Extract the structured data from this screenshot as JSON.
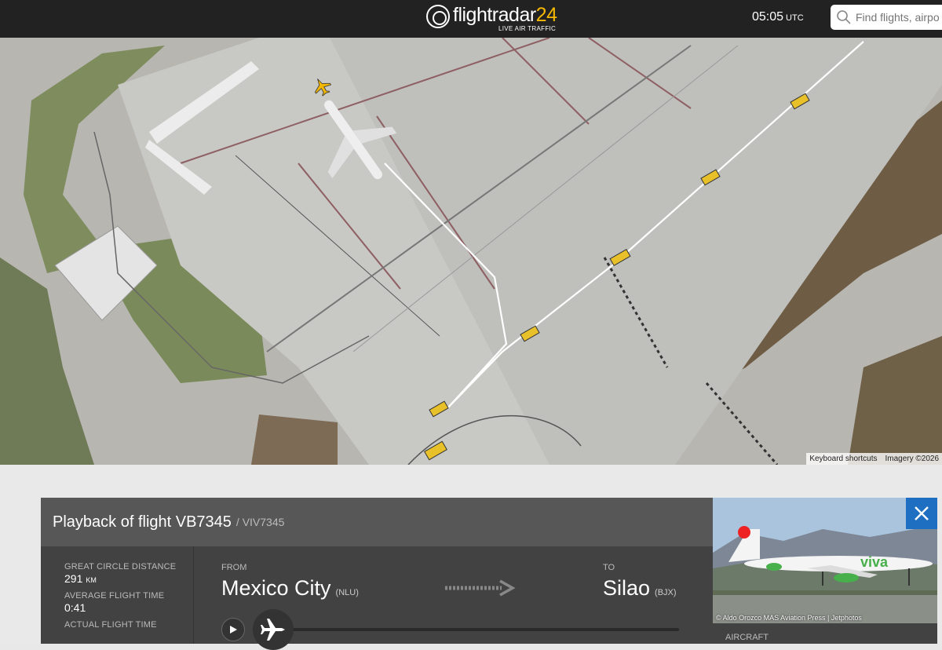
{
  "header": {
    "logo_text_main": "flightradar",
    "logo_text_num": "24",
    "logo_subtitle": "LIVE AIR TRAFFIC",
    "time": "05:05",
    "time_zone": "UTC",
    "search_placeholder": "Find flights, airpo"
  },
  "map": {
    "attribution": [
      "Keyboard shortcuts",
      "Imagery ©2026"
    ]
  },
  "flight_panel": {
    "title": "Playback of flight VB7345",
    "subtitle": "/ VIV7345",
    "stats": [
      {
        "label": "GREAT CIRCLE DISTANCE",
        "value": "291",
        "unit": "KM"
      },
      {
        "label": "AVERAGE FLIGHT TIME",
        "value": "0:41",
        "unit": ""
      },
      {
        "label": "ACTUAL FLIGHT TIME",
        "value": "",
        "unit": ""
      }
    ],
    "from_label": "FROM",
    "from_city": "Mexico City",
    "from_code": "(NLU)",
    "to_label": "TO",
    "to_city": "Silao",
    "to_code": "(BJX)",
    "playback_progress": 0.0
  },
  "photo": {
    "credit": "© Aldo Orozco MAS Aviation Press | Jetphotos",
    "livery_text": "viva"
  },
  "aircraft_section": {
    "label": "AIRCRAFT"
  },
  "colors": {
    "topbar": "#222222",
    "accent_yellow": "#f5b800",
    "close_blue": "#1e6fc2",
    "panel": "#424242"
  }
}
